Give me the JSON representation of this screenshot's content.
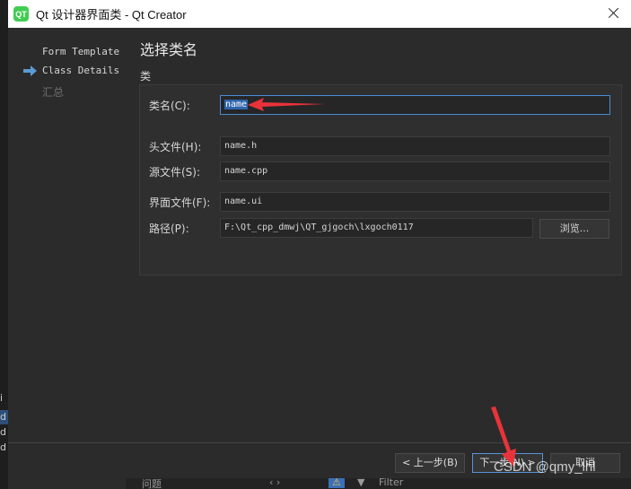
{
  "window": {
    "title": "Qt 设计器界面类 - Qt Creator",
    "app_icon": "qt-logo-icon"
  },
  "sidebar": {
    "steps": [
      {
        "label": "Form Template",
        "state": "done"
      },
      {
        "label": "Class Details",
        "state": "current"
      },
      {
        "label": "汇总",
        "state": "pending"
      }
    ]
  },
  "page": {
    "title": "选择类名",
    "section": "类"
  },
  "form": {
    "class_name": {
      "label": "类名(C):",
      "value": "name"
    },
    "header_file": {
      "label": "头文件(H):",
      "value": "name.h"
    },
    "source_file": {
      "label": "源文件(S):",
      "value": "name.cpp"
    },
    "form_file": {
      "label": "界面文件(F):",
      "value": "name.ui"
    },
    "path": {
      "label": "路径(P):",
      "value": "F:\\Qt_cpp_dmwj\\QT_gjgoch\\lxgoch0117"
    },
    "browse_label": "浏览..."
  },
  "footer": {
    "back_label": "< 上一步(B)",
    "next_label": "下一步(N) >",
    "cancel_label": "取消"
  },
  "background_window": {
    "left_letters": [
      "i",
      "d",
      "d",
      "d"
    ],
    "bottom_tab": "问题",
    "filter_placeholder": "Filter"
  },
  "watermark": "CSDN @qmy_lhl",
  "colors": {
    "accent": "#4a8ad6",
    "annotation_arrow": "#e8333a",
    "qt_green": "#41cd52"
  }
}
